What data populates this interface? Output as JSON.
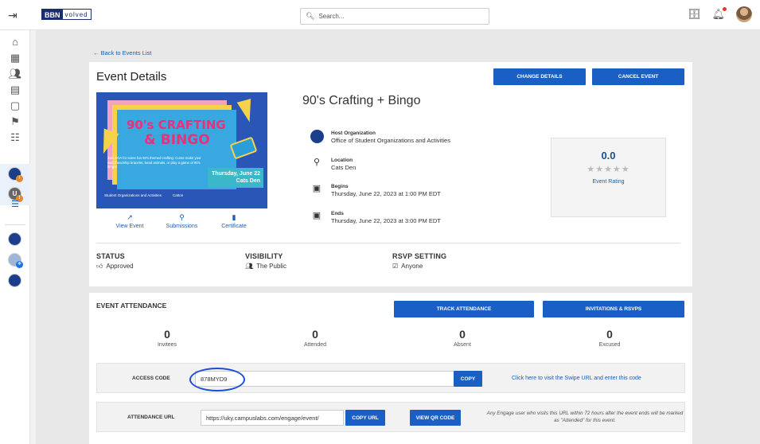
{
  "topbar": {
    "logo_part1": "BBN",
    "logo_part2": "volved",
    "search_placeholder": "Search..."
  },
  "nav": {
    "back_link": "← Back to Events List"
  },
  "event": {
    "section_title": "Event Details",
    "change_details_label": "CHANGE DETAILS",
    "cancel_event_label": "CANCEL EVENT",
    "name": "90's Crafting + Bingo",
    "poster": {
      "title_line1": "90's CRAFTING",
      "title_line2": "& BINGO",
      "blurb": "Join SOA for some fun 90's themed crafting. Come make your own friendship bracelet, bead animals, or play a game of 90's bingo!",
      "date_line1": "Thursday, June 22",
      "date_line2": "Cats Den",
      "logo1": "Student Organizations and Activities",
      "logo2": "Catton"
    },
    "actions": [
      {
        "label": "View Event",
        "icon": "external-link-icon"
      },
      {
        "label": "Submissions",
        "icon": "search-icon"
      },
      {
        "label": "Certificate",
        "icon": "bookmark-icon"
      }
    ],
    "host": {
      "label": "Host Organization",
      "value": "Office of Student Organizations and Activities"
    },
    "location": {
      "label": "Location",
      "value": "Cats Den"
    },
    "begins": {
      "label": "Begins",
      "value": "Thursday, June 22, 2023 at 1:00 PM EDT"
    },
    "ends": {
      "label": "Ends",
      "value": "Thursday, June 22, 2023 at 3:00 PM EDT"
    },
    "rating": {
      "value": "0.0",
      "stars": "★★★★★",
      "label": "Event Rating"
    },
    "status": {
      "label": "STATUS",
      "value": "Approved"
    },
    "visibility": {
      "label": "VISIBILITY",
      "value": "The Public"
    },
    "rsvp": {
      "label": "RSVP SETTING",
      "value": "Anyone"
    }
  },
  "attendance": {
    "title": "EVENT ATTENDANCE",
    "track_label": "TRACK ATTENDANCE",
    "invitations_label": "INVITATIONS & RSVPS",
    "counts": [
      {
        "value": "0",
        "label": "Invitees"
      },
      {
        "value": "0",
        "label": "Attended"
      },
      {
        "value": "0",
        "label": "Absent"
      },
      {
        "value": "0",
        "label": "Excused"
      }
    ],
    "access_code_label": "ACCESS CODE",
    "access_code_value": "878MYD9",
    "copy_label": "COPY",
    "swipe_link": "Click here to visit the Swipe URL and enter this code",
    "url_label": "ATTENDANCE URL",
    "url_value": "https://uky.campuslabs.com/engage/event/",
    "copy_url_label": "COPY URL",
    "qr_label": "VIEW QR CODE",
    "url_note": "Any Engage user who visits this URL within 72 hours after the event ends will be marked as \"Attended\" for this event."
  },
  "colors": {
    "primary": "#1a5fc4",
    "link": "#1a5fb4",
    "brand_navy": "#1a2e6e"
  }
}
